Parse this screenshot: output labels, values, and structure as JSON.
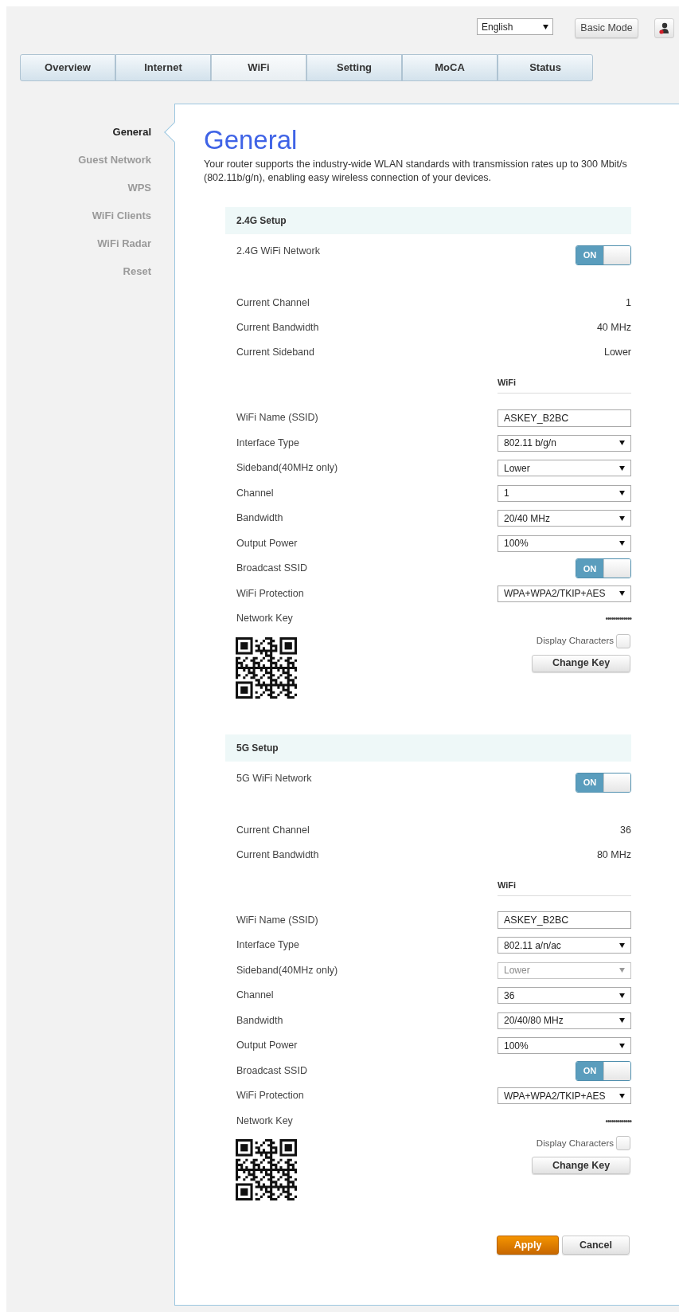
{
  "header": {
    "language": {
      "value": "English"
    },
    "mode_button": "Basic Mode"
  },
  "tabs": [
    {
      "label": "Overview",
      "selected": false
    },
    {
      "label": "Internet",
      "selected": false
    },
    {
      "label": "WiFi",
      "selected": true
    },
    {
      "label": "Setting",
      "selected": false
    },
    {
      "label": "MoCA",
      "selected": false
    },
    {
      "label": "Status",
      "selected": false
    }
  ],
  "sidebar": {
    "items": [
      {
        "label": "General",
        "selected": true
      },
      {
        "label": "Guest Network",
        "selected": false
      },
      {
        "label": "WPS",
        "selected": false
      },
      {
        "label": "WiFi Clients",
        "selected": false
      },
      {
        "label": "WiFi Radar",
        "selected": false
      },
      {
        "label": "Reset",
        "selected": false
      }
    ]
  },
  "page": {
    "title": "General",
    "description": "Your router supports the industry-wide WLAN standards with transmission rates up to 300 Mbit/s (802.11b/g/n), enabling easy wireless connection of your devices."
  },
  "sections": [
    {
      "title": "2.4G Setup",
      "network_toggle": {
        "label": "2.4G WiFi Network",
        "on": true,
        "text": "ON"
      },
      "status": [
        {
          "label": "Current Channel",
          "value": "1"
        },
        {
          "label": "Current Bandwidth",
          "value": "40 MHz"
        },
        {
          "label": "Current Sideband",
          "value": "Lower"
        }
      ],
      "subheading": "WiFi",
      "fields": [
        {
          "kind": "input",
          "label": "WiFi Name (SSID)",
          "value": "ASKEY_B2BC"
        },
        {
          "kind": "select",
          "label": "Interface Type",
          "value": "802.11 b/g/n",
          "disabled": false
        },
        {
          "kind": "select",
          "label": "Sideband(40MHz only)",
          "value": "Lower",
          "disabled": false
        },
        {
          "kind": "select",
          "label": "Channel",
          "value": "1",
          "disabled": false
        },
        {
          "kind": "select",
          "label": "Bandwidth",
          "value": "20/40 MHz",
          "disabled": false
        },
        {
          "kind": "select",
          "label": "Output Power",
          "value": "100%",
          "disabled": false
        },
        {
          "kind": "toggle",
          "label": "Broadcast SSID",
          "on": true,
          "text": "ON"
        },
        {
          "kind": "select",
          "label": "WiFi Protection",
          "value": "WPA+WPA2/TKIP+AES",
          "disabled": false
        },
        {
          "kind": "key",
          "label": "Network Key",
          "value": "•••••••••••••"
        }
      ],
      "display_characters": {
        "label": "Display Characters",
        "checked": false
      },
      "change_key_button": "Change Key"
    },
    {
      "title": "5G Setup",
      "network_toggle": {
        "label": "5G WiFi Network",
        "on": true,
        "text": "ON"
      },
      "status": [
        {
          "label": "Current Channel",
          "value": "36"
        },
        {
          "label": "Current Bandwidth",
          "value": "80 MHz"
        }
      ],
      "subheading": "WiFi",
      "fields": [
        {
          "kind": "input",
          "label": "WiFi Name (SSID)",
          "value": "ASKEY_B2BC"
        },
        {
          "kind": "select",
          "label": "Interface Type",
          "value": "802.11 a/n/ac",
          "disabled": false
        },
        {
          "kind": "select",
          "label": "Sideband(40MHz only)",
          "value": "Lower",
          "disabled": true
        },
        {
          "kind": "select",
          "label": "Channel",
          "value": "36",
          "disabled": false
        },
        {
          "kind": "select",
          "label": "Bandwidth",
          "value": "20/40/80 MHz",
          "disabled": false
        },
        {
          "kind": "select",
          "label": "Output Power",
          "value": "100%",
          "disabled": false
        },
        {
          "kind": "toggle",
          "label": "Broadcast SSID",
          "on": true,
          "text": "ON"
        },
        {
          "kind": "select",
          "label": "WiFi Protection",
          "value": "WPA+WPA2/TKIP+AES",
          "disabled": false
        },
        {
          "kind": "key",
          "label": "Network Key",
          "value": "•••••••••••••"
        }
      ],
      "display_characters": {
        "label": "Display Characters",
        "checked": false
      },
      "change_key_button": "Change Key"
    }
  ],
  "buttons": [
    {
      "label": "Apply",
      "kind": "primary"
    },
    {
      "label": "Cancel",
      "kind": "secondary"
    }
  ]
}
